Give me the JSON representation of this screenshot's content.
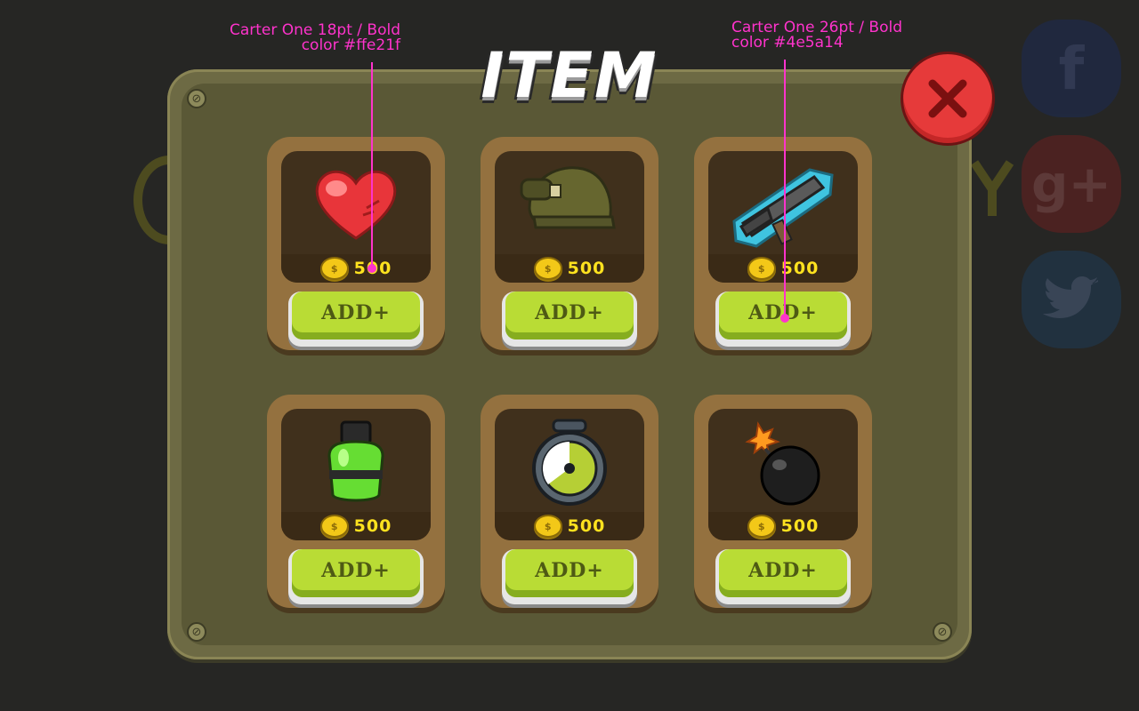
{
  "title": "ITEM",
  "annotations": [
    {
      "line1": "Carter One 18pt / Bold",
      "line2": "color #ffe21f"
    },
    {
      "line1": "Carter One 26pt / Bold",
      "line2": "color #4e5a14"
    }
  ],
  "items": [
    {
      "icon": "heart-icon",
      "price": "500",
      "button": "ADD+"
    },
    {
      "icon": "helmet-icon",
      "price": "500",
      "button": "ADD+"
    },
    {
      "icon": "rocket-launcher-icon",
      "price": "500",
      "button": "ADD+"
    },
    {
      "icon": "potion-bottle-icon",
      "price": "500",
      "button": "ADD+"
    },
    {
      "icon": "stopwatch-icon",
      "price": "500",
      "button": "ADD+"
    },
    {
      "icon": "bomb-icon",
      "price": "500",
      "button": "ADD+"
    }
  ],
  "social": [
    {
      "icon": "facebook-icon",
      "label": "f"
    },
    {
      "icon": "google-plus-icon",
      "label": "g+"
    },
    {
      "icon": "twitter-icon",
      "label": ""
    }
  ],
  "colors": {
    "price": "#ffe21f",
    "button_text": "#4e5a14",
    "button": "#b9dc35",
    "close": "#e63a3a"
  }
}
